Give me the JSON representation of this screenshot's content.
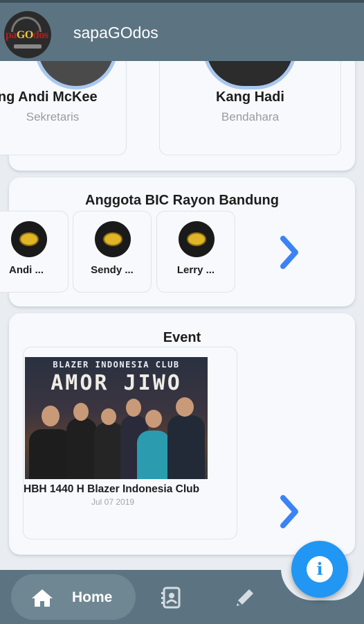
{
  "app": {
    "title": "sapaGOdos",
    "logo_text_left": "pa",
    "logo_text_mid": "GO",
    "logo_text_right": "dos"
  },
  "officers": [
    {
      "name": "Kang Andi McKee",
      "role": "Sekretaris"
    },
    {
      "name": "Kang Hadi",
      "role": "Bendahara"
    }
  ],
  "members_section": {
    "title": "Anggota BIC Rayon Bandung",
    "members": [
      {
        "name": "Andi ..."
      },
      {
        "name": "Sendy ..."
      },
      {
        "name": "Lerry ..."
      }
    ]
  },
  "event_section": {
    "title": "Event",
    "events": [
      {
        "banner_top": "BLAZER INDONESIA CLUB",
        "banner_big": "AMOR JIWO",
        "name": "HBH 1440 H Blazer Indonesia Club",
        "date": "Jul 07 2019"
      }
    ]
  },
  "bottom_nav": {
    "home_label": "Home"
  },
  "colors": {
    "appbar": "#5c7482",
    "accent": "#2196f3",
    "chevron": "#3b82f6",
    "card": "#f7f9fc"
  }
}
